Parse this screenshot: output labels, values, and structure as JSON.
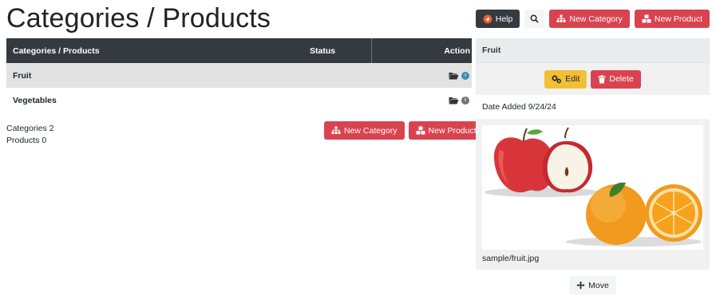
{
  "page": {
    "title": "Categories / Products"
  },
  "toolbar": {
    "help_label": "Help",
    "new_category_label": "New Category",
    "new_product_label": "New Product"
  },
  "table": {
    "headers": {
      "name": "Categories / Products",
      "status": "Status",
      "action": "Action"
    },
    "rows": [
      {
        "name": "Fruit",
        "selected": true,
        "status_icon": "chevron-right-circle-icon"
      },
      {
        "name": "Vegetables",
        "selected": false,
        "status_icon": "info-circle-icon"
      }
    ]
  },
  "summary": {
    "categories": "Categories 2",
    "products": "Products 0"
  },
  "bottom_toolbar": {
    "new_category_label": "New Category",
    "new_product_label": "New Product"
  },
  "detail": {
    "title": "Fruit",
    "edit_label": "Edit",
    "delete_label": "Delete",
    "date_added": "Date Added 9/24/24",
    "image_caption": "sample/fruit.jpg",
    "move_label": "Move"
  },
  "colors": {
    "dark": "#343a40",
    "danger": "#d9434f",
    "warning": "#f2c037",
    "info": "#3f8fb3"
  }
}
